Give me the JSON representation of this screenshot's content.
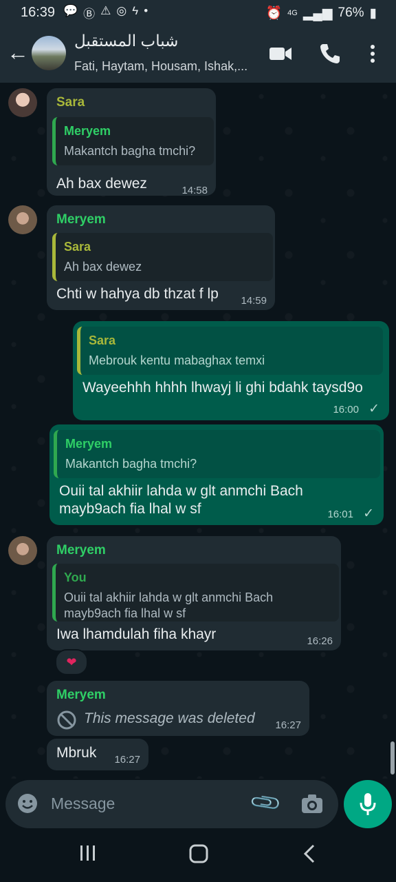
{
  "status_bar": {
    "time": "16:39",
    "signal": "4G",
    "battery": "76%",
    "notification_icons": [
      "chat-bubble-icon",
      "messenger-app-icon",
      "warning-icon",
      "instagram-icon",
      "messenger-icon",
      "dot-icon"
    ]
  },
  "header": {
    "title": "شباب المستقبل",
    "subtitle": "Fati, Haytam, Housam, Ishak,..."
  },
  "colors": {
    "sara": "#a9b83a",
    "meryem": "#2fcf66",
    "you": "#2fa84f",
    "incoming_bubble": "#202c33",
    "outgoing_bubble": "#005c4b",
    "accent": "#00a884"
  },
  "messages": [
    {
      "sender": "Sara",
      "quote_name": "Meryem",
      "quote_text": "Makantch bagha tmchi?",
      "text": "Ah bax dewez",
      "time": "14:58"
    },
    {
      "sender": "Meryem",
      "quote_name": "Sara",
      "quote_text": "Ah bax dewez",
      "text": "Chti w hahya db thzat f lp",
      "time": "14:59"
    },
    {
      "quote_name": "Sara",
      "quote_text": "Mebrouk kentu mabaghax temxi",
      "text": "Wayeehhh hhhh lhwayj li ghi bdahk taysd9o",
      "time": "16:00"
    },
    {
      "quote_name": "Meryem",
      "quote_text": "Makantch bagha tmchi?",
      "text_line1": "Ouii tal akhiir lahda w glt anmchi Bach",
      "text_line2": "mayb9ach fia lhal w sf",
      "time": "16:01"
    },
    {
      "sender": "Meryem",
      "quote_name": "You",
      "quote_text_line1": "Ouii tal akhiir lahda w glt anmchi Bach",
      "quote_text_line2": "mayb9ach fia lhal w sf",
      "text": "Iwa lhamdulah fiha khayr",
      "time": "16:26",
      "reaction": "❤"
    },
    {
      "sender": "Meryem",
      "text": "This message was deleted",
      "time": "16:27"
    },
    {
      "text": "Mbruk",
      "time": "16:27"
    }
  ],
  "composer": {
    "placeholder": "Message"
  }
}
